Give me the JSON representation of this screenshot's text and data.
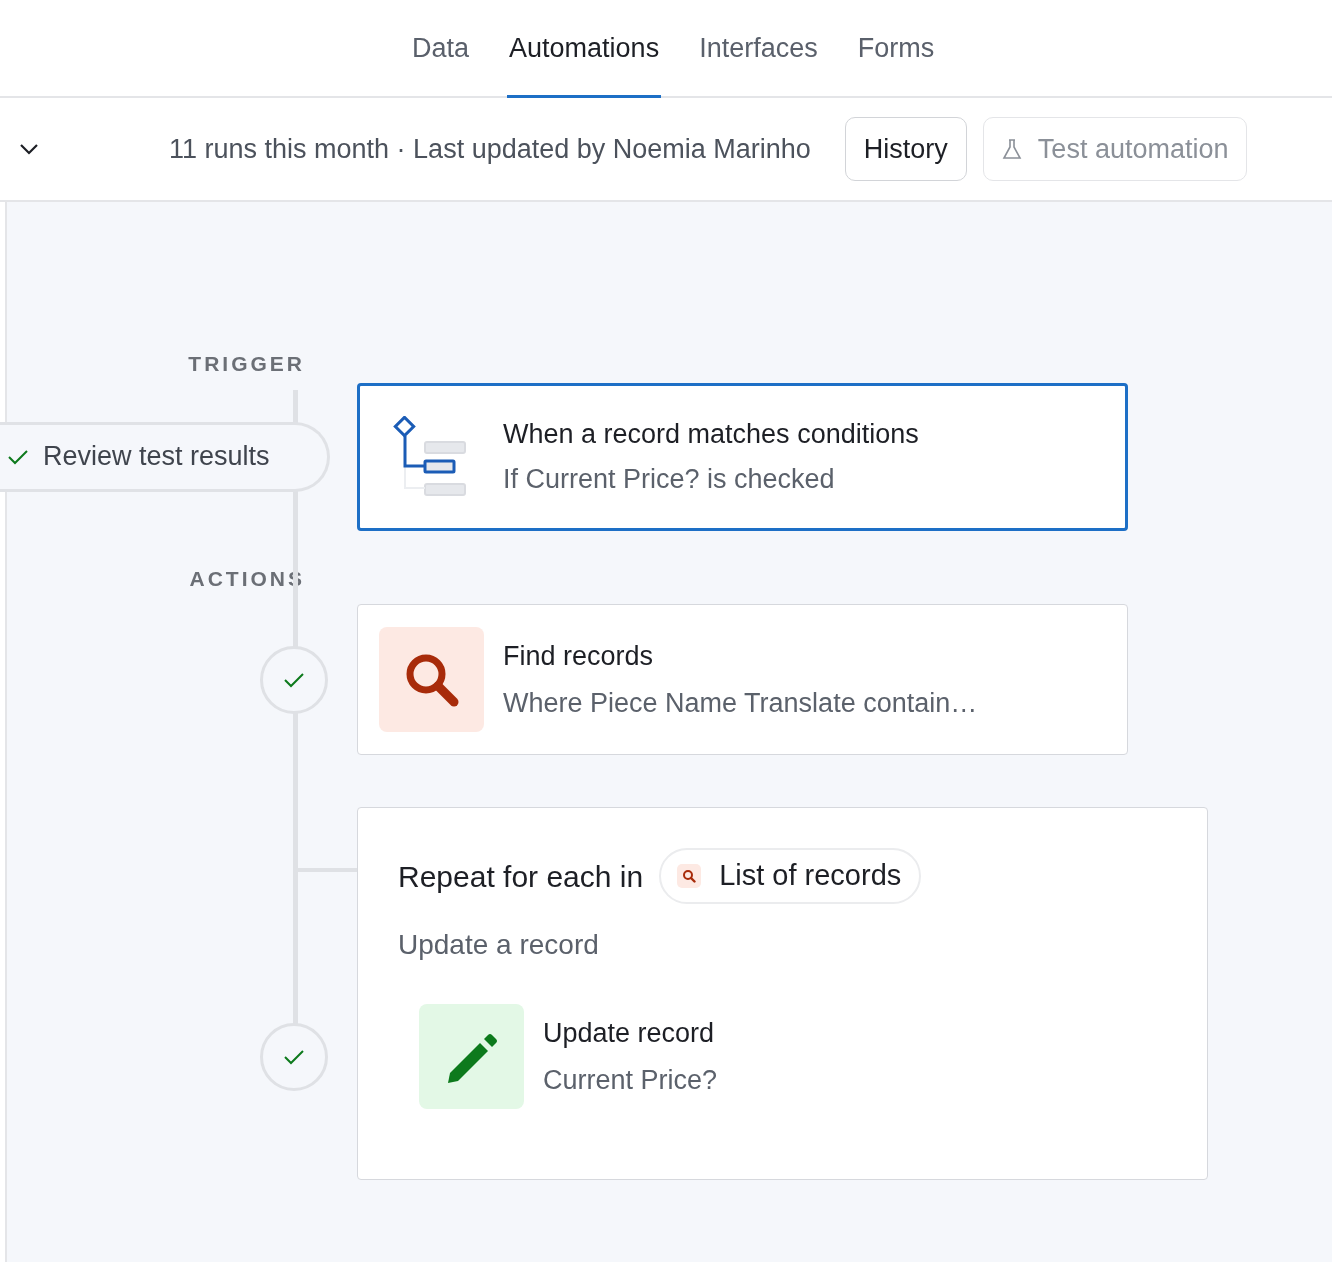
{
  "tabs": [
    {
      "label": "Data",
      "selected": false
    },
    {
      "label": "Automations",
      "selected": true
    },
    {
      "label": "Interfaces",
      "selected": false
    },
    {
      "label": "Forms",
      "selected": false
    }
  ],
  "toolbar": {
    "summary": "11 runs this month · Last updated by Noemia Marinho",
    "buttons": [
      {
        "kind": "plain",
        "label": "History",
        "disabled": false
      },
      {
        "kind": "test",
        "label": "Test automation",
        "disabled": true
      }
    ]
  },
  "trigger": {
    "label": "TRIGGER",
    "test_results": {
      "label": "Review test results",
      "checked": true
    },
    "step": {
      "kind": "conditions",
      "title": "When a record matches conditions",
      "subtitle": "If Current Price? is checked",
      "selected": true
    }
  },
  "actions": {
    "label": "ACTIONS",
    "steps": [
      {
        "kind": "find",
        "title": "Find records",
        "subtitle": "Where Piece Name Translate contain…",
        "completed": true
      },
      {
        "kind": "repeat",
        "title": "Repeat for each in",
        "source": "List of records",
        "subtitle": "Update a record",
        "completed": true,
        "children": [
          {
            "kind": "update",
            "title": "Update record",
            "subtitle": "Current Price?"
          }
        ]
      }
    ]
  }
}
